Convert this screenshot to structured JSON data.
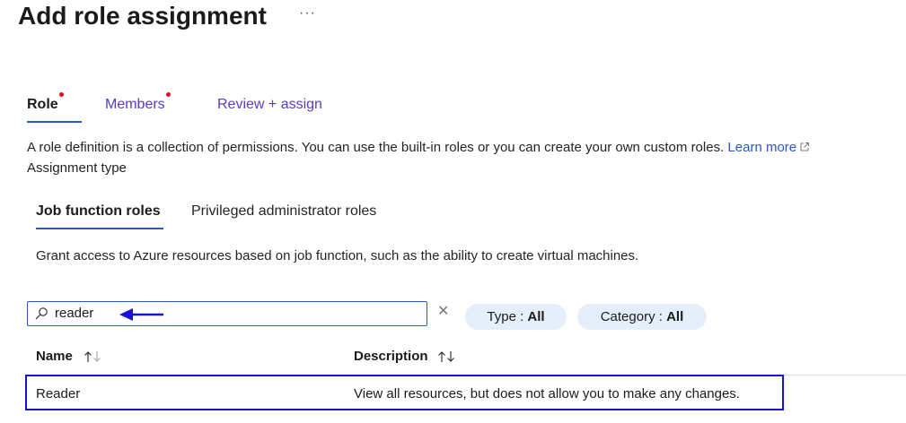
{
  "header": {
    "title": "Add role assignment",
    "more_label": "···"
  },
  "tabs": [
    {
      "label": "Role",
      "active": true,
      "required_dot": true
    },
    {
      "label": "Members",
      "active": false,
      "required_dot": true
    },
    {
      "label": "Review + assign",
      "active": false,
      "required_dot": false
    }
  ],
  "description": {
    "text": "A role definition is a collection of permissions. You can use the built-in roles or you can create your own custom roles.",
    "link_label": "Learn more"
  },
  "assignment_type_label": "Assignment type",
  "subtabs": [
    {
      "label": "Job function roles",
      "active": true
    },
    {
      "label": "Privileged administrator roles",
      "active": false
    }
  ],
  "grant_text": "Grant access to Azure resources based on job function, such as the ability to create virtual machines.",
  "search": {
    "value": "reader"
  },
  "filters": {
    "type": {
      "label": "Type :",
      "value": "All"
    },
    "category": {
      "label": "Category :",
      "value": "All"
    }
  },
  "table": {
    "columns": [
      "Name",
      "Description"
    ],
    "rows": [
      {
        "name": "Reader",
        "description": "View all resources, but does not allow you to make any changes."
      }
    ]
  },
  "colors": {
    "accent": "#2b59c3",
    "tab_link": "#5b3ac4",
    "required_dot": "#e00b1c",
    "annotation": "#1a0fd6",
    "pill_bg": "#e5effb"
  }
}
